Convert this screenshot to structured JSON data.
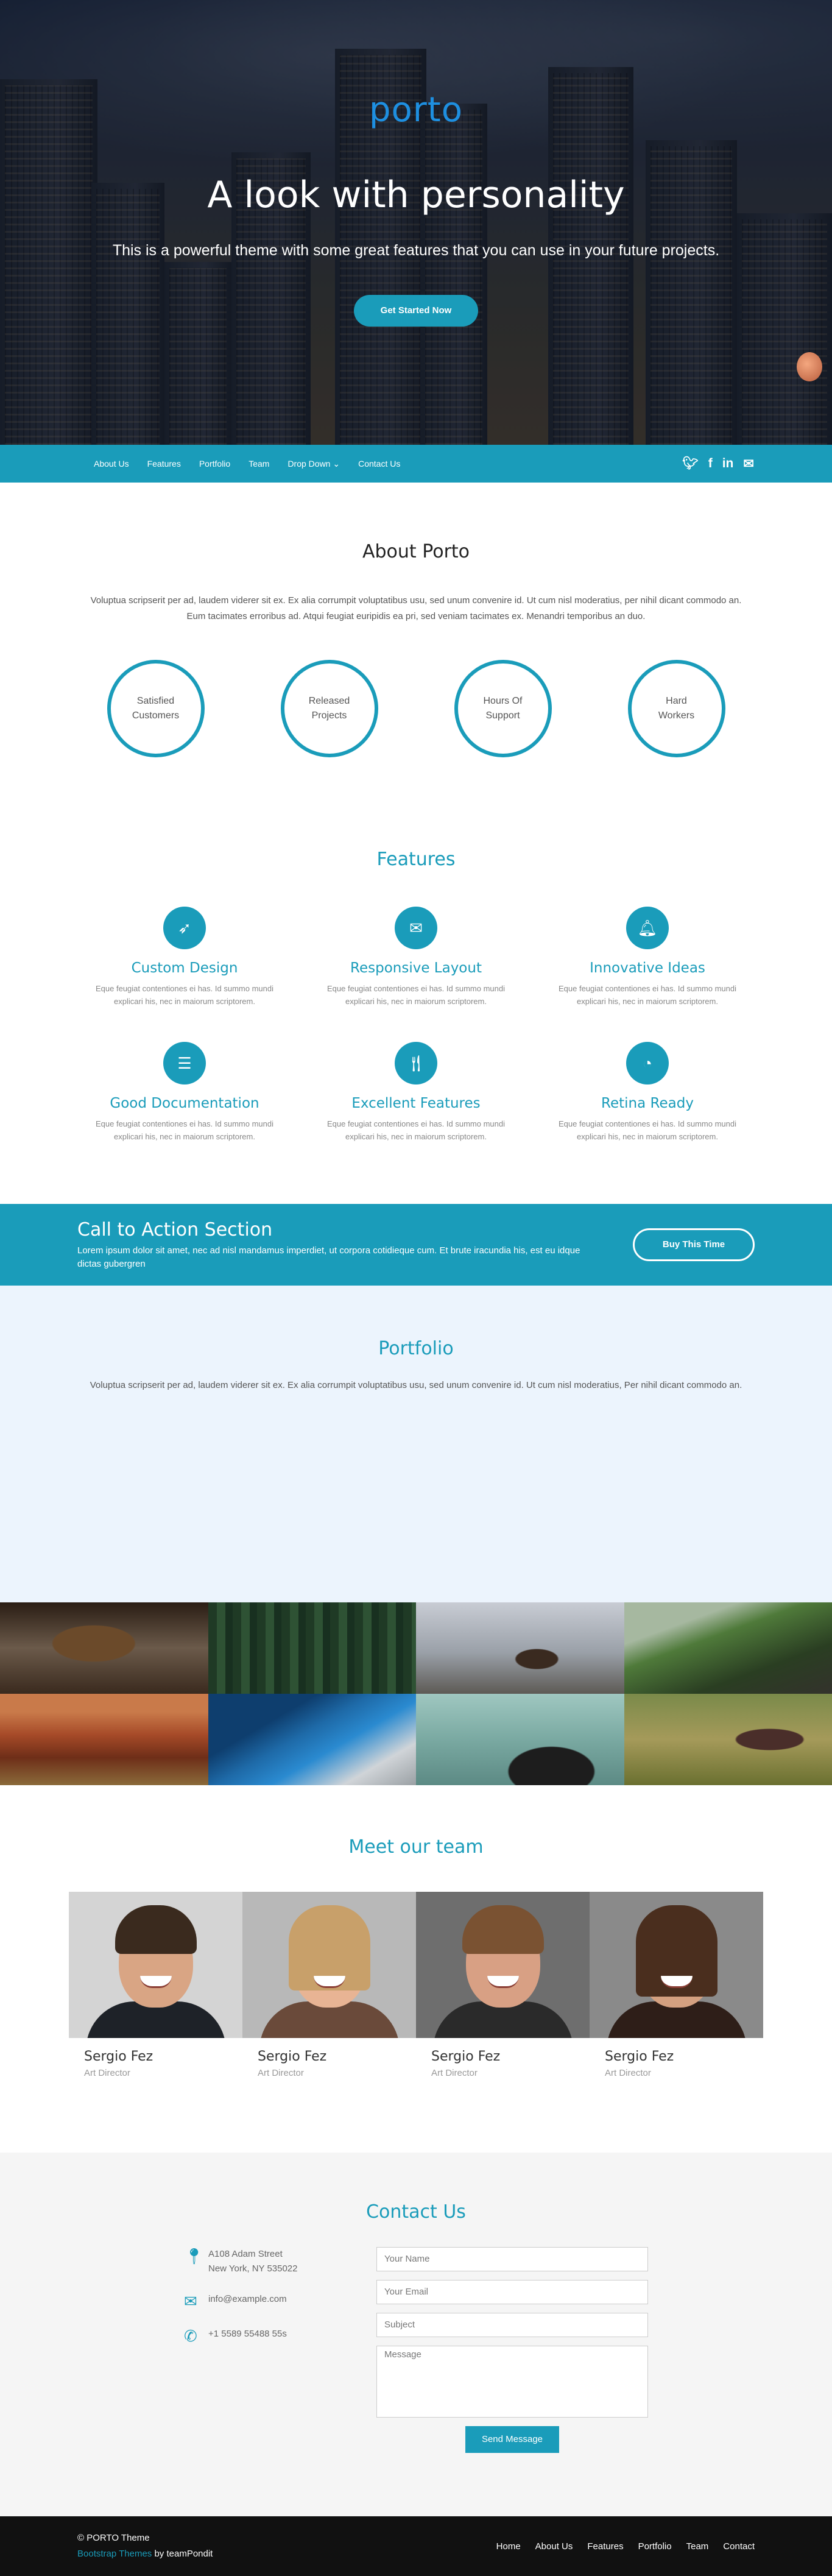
{
  "hero": {
    "logo": "porto",
    "headline": "A look with personality",
    "tagline": "This is a powerful theme with some great features that you can use in your future projects.",
    "cta": "Get Started Now"
  },
  "nav": {
    "items": [
      "About Us",
      "Features",
      "Portfolio",
      "Team",
      "Drop Down ⌄",
      "Contact Us"
    ],
    "socials": [
      "twitter-icon",
      "facebook-icon",
      "linkedin-icon",
      "email-icon"
    ]
  },
  "about": {
    "title": "About Porto",
    "text": "Voluptua scripserit per ad, laudem viderer sit ex. Ex alia corrumpit voluptatibus usu, sed unum convenire id. Ut cum nisl moderatius, per nihil dicant commodo an. Eum tacimates erroribus ad. Atqui feugiat euripidis ea pri, sed veniam tacimates ex. Menandri temporibus an duo.",
    "stats": [
      {
        "line1": "Satisfied",
        "line2": "Customers"
      },
      {
        "line1": "Released",
        "line2": "Projects"
      },
      {
        "line1": "Hours Of",
        "line2": "Support"
      },
      {
        "line1": "Hard",
        "line2": "Workers"
      }
    ]
  },
  "features": {
    "title": "Features",
    "items": [
      {
        "icon": "rocket-icon",
        "title": "Custom Design",
        "text": "Eque feugiat contentiones ei has. Id summo mundi explicari his, nec in maiorum scriptorem."
      },
      {
        "icon": "envelope-icon",
        "title": "Responsive Layout",
        "text": "Eque feugiat contentiones ei has. Id summo mundi explicari his, nec in maiorum scriptorem."
      },
      {
        "icon": "bell-icon",
        "title": "Innovative Ideas",
        "text": "Eque feugiat contentiones ei has. Id summo mundi explicari his, nec in maiorum scriptorem."
      },
      {
        "icon": "database-icon",
        "title": "Good Documentation",
        "text": "Eque feugiat contentiones ei has. Id summo mundi explicari his, nec in maiorum scriptorem."
      },
      {
        "icon": "cutlery-icon",
        "title": "Excellent Features",
        "text": "Eque feugiat contentiones ei has. Id summo mundi explicari his, nec in maiorum scriptorem."
      },
      {
        "icon": "dashboard-icon",
        "title": "Retina Ready",
        "text": "Eque feugiat contentiones ei has. Id summo mundi explicari his, nec in maiorum scriptorem."
      }
    ]
  },
  "cta": {
    "title": "Call to Action Section",
    "text": "Lorem ipsum dolor sit amet, nec ad nisl mandamus imperdiet, ut corpora cotidieque cum. Et brute iracundia his, est eu idque dictas gubergren",
    "button": "Buy This Time"
  },
  "portfolio": {
    "title": "Portfolio",
    "text": "Voluptua scripserit per ad, laudem viderer sit ex. Ex alia corrumpit voluptatibus usu, sed unum convenire id. Ut cum nisl moderatius, Per nihil dicant commodo an."
  },
  "team": {
    "title": "Meet our team",
    "members": [
      {
        "name": "Sergio Fez",
        "role": "Art Director"
      },
      {
        "name": "Sergio Fez",
        "role": "Art Director"
      },
      {
        "name": "Sergio Fez",
        "role": "Art Director"
      },
      {
        "name": "Sergio Fez",
        "role": "Art Director"
      }
    ]
  },
  "contact": {
    "title": "Contact Us",
    "address1": "A108 Adam Street",
    "address2": "New York, NY 535022",
    "email": "info@example.com",
    "phone": "+1 5589 55488 55s",
    "name_placeholder": "Your Name",
    "email_placeholder": "Your Email",
    "subject_placeholder": "Subject",
    "message_placeholder": "Message",
    "send": "Send Message"
  },
  "footer": {
    "copyright": "© PORTO Theme",
    "credit_link": "Bootstrap Themes",
    "credit_rest": " by teamPondit",
    "links": [
      "Home",
      "About Us",
      "Features",
      "Portfolio",
      "Team",
      "Contact"
    ]
  },
  "colors": {
    "accent": "#1a9cba",
    "logo": "#1e8fe0",
    "portfolio_bg": "#ecf4fd",
    "contact_bg": "#f5f5f5",
    "footer_bg": "#111111"
  }
}
